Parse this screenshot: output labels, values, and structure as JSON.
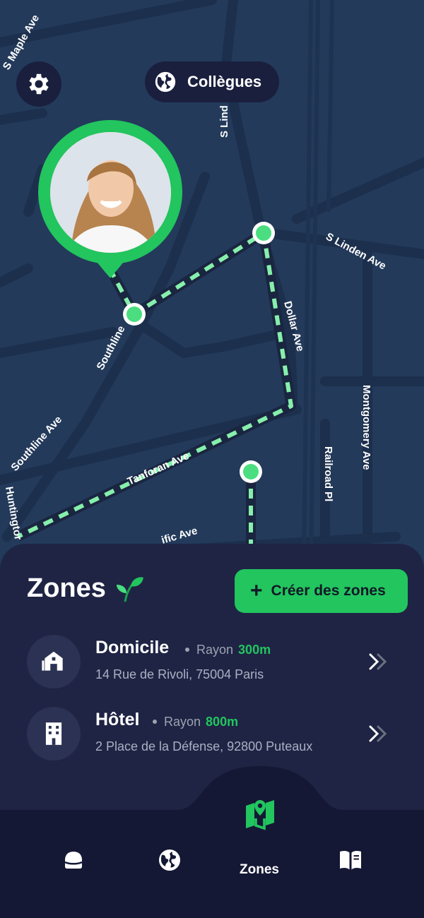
{
  "map": {
    "streets": {
      "s_maple_ave": "S Maple Ave",
      "s_linden_top": "S Lind",
      "s_linden_ave": "S Linden Ave",
      "southline": "Southline",
      "dollar_ave": "Dollar Ave",
      "montgomery_ave": "Montgomery Ave",
      "railroad_pl": "Railroad Pl",
      "southline_ave": "Southline Ave",
      "tanforan_ave": "Tanforan Ave",
      "huntington": "Huntingtor",
      "pacific_ave": "ific Ave"
    },
    "colors": {
      "background": "#233a5b",
      "route": "#86efac",
      "accent": "#22c55e"
    }
  },
  "header": {
    "settings_icon": "gear-icon",
    "pill_icon": "globe-icon",
    "pill_label": "Collègues"
  },
  "avatar": {
    "status_color": "#22c55e"
  },
  "zones": {
    "title": "Zones",
    "title_icon": "sprout-icon",
    "create_button_label": "Créer des zones",
    "items": [
      {
        "name": "Domicile",
        "radius_label": "Rayon",
        "radius_value": "300m",
        "address": "14 Rue de Rivoli, 75004 Paris",
        "icon": "home-icon"
      },
      {
        "name": "Hôtel",
        "radius_label": "Rayon",
        "radius_value": "800m",
        "address": "2 Place de la Défense, 92800 Puteaux",
        "icon": "hotel-icon"
      }
    ]
  },
  "nav": {
    "items": [
      {
        "icon": "hat-icon"
      },
      {
        "icon": "globe-icon"
      },
      {
        "icon": "map-pin-icon",
        "label": "Zones",
        "active": true
      },
      {
        "icon": "book-icon"
      }
    ]
  }
}
